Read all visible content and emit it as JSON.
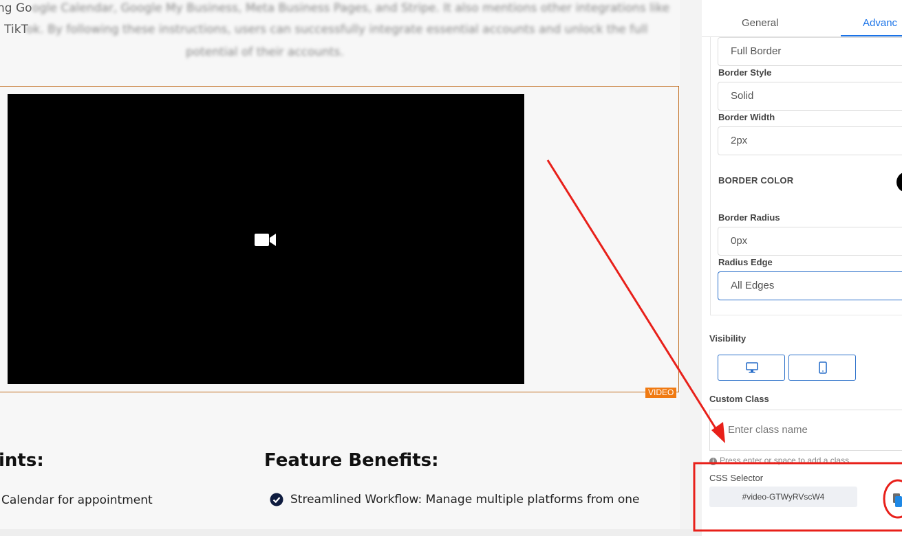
{
  "canvas": {
    "paragraph_lines": [
      {
        "clear": "ng Go",
        "fuzzy": "ogle Calendar, Google My Business, Meta Business Pages, and Stripe. It also mentions other integrations like"
      },
      {
        "clear": "l TikT",
        "fuzzy": "ok. By following these instructions, users can successfully integrate essential accounts and unlock the full"
      },
      {
        "clear": "",
        "fuzzy": "potential of their accounts."
      }
    ],
    "video_badge": "VIDEO",
    "left_heading": "ints:",
    "right_heading": "Feature Benefits:",
    "left_bullet": "Calendar for appointment",
    "right_bullet": "Streamlined Workflow: Manage multiple platforms from one"
  },
  "panel": {
    "tabs": [
      {
        "label": "General",
        "active": false
      },
      {
        "label": "Advanc",
        "active": true
      }
    ],
    "border_type_value": "Full Border",
    "border_style_label": "Border Style",
    "border_style_value": "Solid",
    "border_width_label": "Border Width",
    "border_width_value": "2px",
    "border_color_label": "BORDER COLOR",
    "border_color": "#000000",
    "border_radius_label": "Border Radius",
    "border_radius_value": "0px",
    "radius_edge_label": "Radius Edge",
    "radius_edge_value": "All Edges",
    "visibility_label": "Visibility",
    "visibility_icons": [
      "desktop-icon",
      "mobile-icon"
    ],
    "custom_class_label": "Custom Class",
    "custom_class_placeholder": "Enter class name",
    "custom_class_hint": "Press enter or space to add a class",
    "css_selector_label": "CSS Selector",
    "css_selector_value": "#video-GTWyRVscW4"
  },
  "colors": {
    "accent": "#1a73e8",
    "annotation_red": "#e8201a",
    "video_badge": "#f07a12"
  }
}
